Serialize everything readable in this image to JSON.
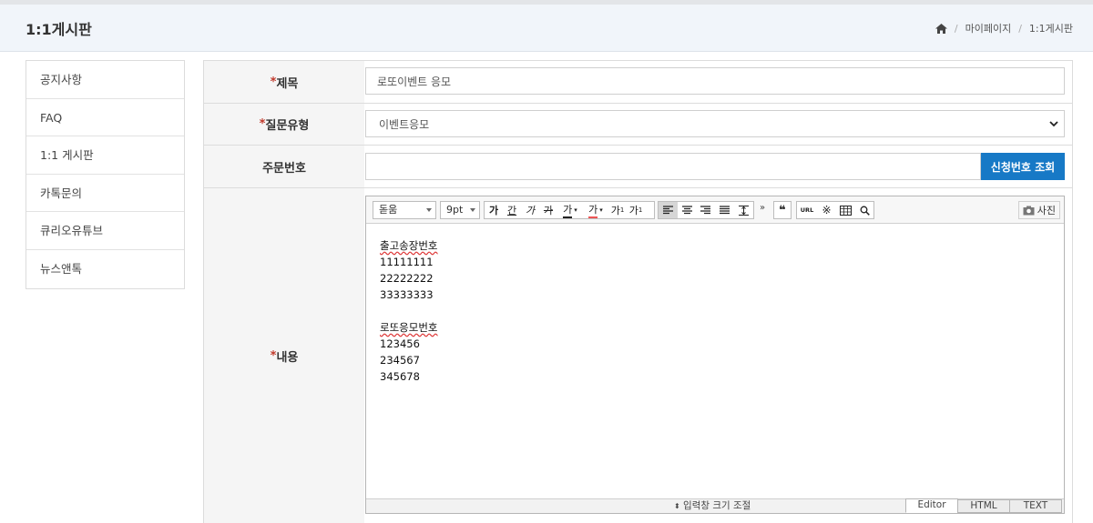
{
  "header": {
    "title": "1:1게시판",
    "breadcrumb": [
      "마이페이지",
      "1:1게시판"
    ]
  },
  "sidebar": {
    "items": [
      {
        "label": "공지사항"
      },
      {
        "label": "FAQ"
      },
      {
        "label": "1:1 게시판"
      },
      {
        "label": "카톡문의"
      },
      {
        "label": "큐리오유튜브"
      },
      {
        "label": "뉴스앤톡"
      }
    ]
  },
  "form": {
    "title": {
      "required_mark": "*",
      "label": "제목",
      "value": "로또이벤트 응모"
    },
    "question_type": {
      "required_mark": "*",
      "label": "질문유형",
      "value": "이벤트응모"
    },
    "order_no": {
      "label": "주문번호",
      "value": "",
      "lookup_label": "신청번호 조회"
    },
    "content": {
      "required_mark": "*",
      "label": "내용"
    }
  },
  "editor": {
    "font": "돋움",
    "size": "9pt",
    "photo_label": "사진",
    "resize_label": "입력창 크기 조절",
    "modes": [
      "Editor",
      "HTML",
      "TEXT"
    ],
    "active_mode": "Editor",
    "body": {
      "heading1": "출고송장번호",
      "lines1": [
        "11111111",
        "22222222",
        "33333333"
      ],
      "heading2": "로또응모번호",
      "lines2": [
        "123456",
        "234567",
        "345678"
      ]
    }
  },
  "colors": {
    "accent": "#1779c6",
    "required": "#c0392b"
  }
}
